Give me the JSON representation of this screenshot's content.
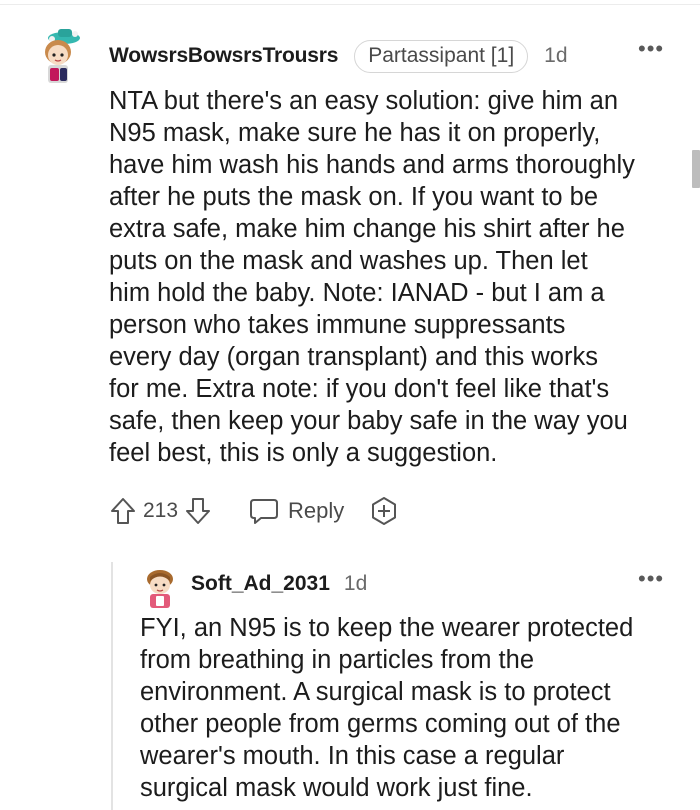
{
  "comment": {
    "username": "WowsrsBowsrsTrousrs",
    "flair": "Partassipant [1]",
    "age": "1d",
    "body_lines": [
      "NTA but there's an easy solution: give him an",
      "N95 mask, make sure he has it on properly,",
      "have him wash his hands and arms thoroughly",
      "after he puts the mask on. If you want to be",
      "extra safe, make him change his shirt after he",
      "puts on the mask and washes up. Then let",
      "him hold the baby. Note: IANAD - but I am a",
      "person who takes immune suppressants",
      "every day (organ transplant) and this works",
      "for me. Extra note: if you don't feel like that's",
      "safe, then keep your baby safe in the way you",
      "feel best, this is only a suggestion."
    ],
    "score": "213",
    "reply_label": "Reply",
    "icons": {
      "upvote": "upvote-icon",
      "downvote": "downvote-icon",
      "reply": "reply-bubble-icon",
      "award": "award-plus-icon",
      "more": "more-options-icon"
    }
  },
  "reply": {
    "username": "Soft_Ad_2031",
    "age": "1d",
    "body_lines": [
      "FYI, an N95 is to keep the wearer protected",
      "from breathing in particles from the",
      "environment. A surgical mask is to protect",
      "other people from germs coming out of the",
      "wearer's mouth. In this case a regular",
      "surgical mask would work just fine."
    ]
  },
  "colors": {
    "text": "#1c1c1c",
    "meta": "#6a6a6a",
    "border": "#d6d6d6",
    "thread_line": "#e3e3e3"
  }
}
